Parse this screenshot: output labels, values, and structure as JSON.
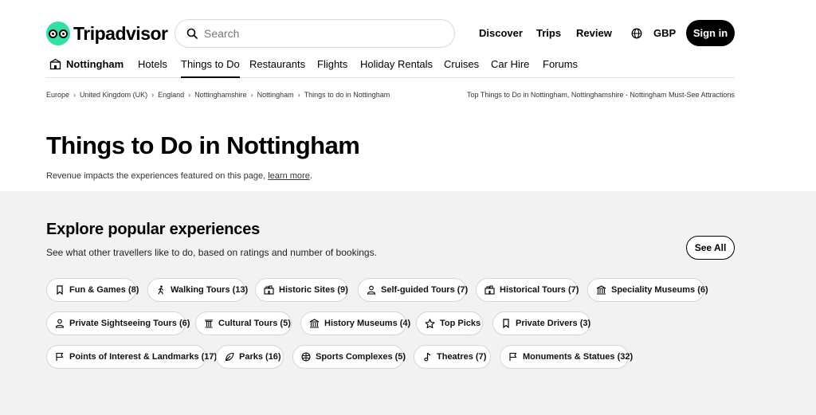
{
  "header": {
    "logo_text": "Tripadvisor",
    "search_placeholder": "Search",
    "nav": [
      "Discover",
      "Trips",
      "Review"
    ],
    "currency": "GBP",
    "sign_in": "Sign in"
  },
  "catnav": {
    "location": "Nottingham",
    "items": [
      "Hotels",
      "Things to Do",
      "Restaurants",
      "Flights",
      "Holiday Rentals",
      "Cruises",
      "Car Hire",
      "Forums"
    ],
    "active": "Things to Do"
  },
  "breadcrumbs": [
    "Europe",
    "United Kingdom (UK)",
    "England",
    "Nottinghamshire",
    "Nottingham",
    "Things to do in Nottingham"
  ],
  "breadcrumb_right": "Top Things to Do in Nottingham, Nottinghamshire - Nottingham Must-See Attractions",
  "page": {
    "title": "Things to Do in Nottingham",
    "disclaimer_text": "Revenue impacts the experiences featured on this page, ",
    "learn_more": "learn more",
    "disclaimer_end": "."
  },
  "experiences": {
    "title": "Explore popular experiences",
    "subtitle": "See what other travellers like to do, based on ratings and number of bookings.",
    "see_all": "See All",
    "pills": [
      {
        "label": "Fun & Games (8)",
        "icon": "bookmark-icon"
      },
      {
        "label": "Walking Tours (13)",
        "icon": "walker-icon"
      },
      {
        "label": "Historic Sites (9)",
        "icon": "landmark-icon"
      },
      {
        "label": "Self-guided Tours (7)",
        "icon": "person-icon"
      },
      {
        "label": "Historical Tours (7)",
        "icon": "landmark-icon"
      },
      {
        "label": "Speciality Museums (6)",
        "icon": "museum-icon"
      },
      {
        "label": "Private Sightseeing Tours (6)",
        "icon": "person-icon"
      },
      {
        "label": "Cultural Tours (5)",
        "icon": "column-icon"
      },
      {
        "label": "History Museums (4)",
        "icon": "museum-icon"
      },
      {
        "label": "Top Picks",
        "icon": "star-icon"
      },
      {
        "label": "Private Drivers (3)",
        "icon": "bookmark-icon"
      },
      {
        "label": "Points of Interest & Landmarks (17)",
        "icon": "flag-icon"
      },
      {
        "label": "Parks (16)",
        "icon": "leaf-icon"
      },
      {
        "label": "Sports Complexes (5)",
        "icon": "ball-icon"
      },
      {
        "label": "Theatres (7)",
        "icon": "music-note-icon"
      },
      {
        "label": "Monuments & Statues (32)",
        "icon": "flag-icon"
      }
    ]
  }
}
